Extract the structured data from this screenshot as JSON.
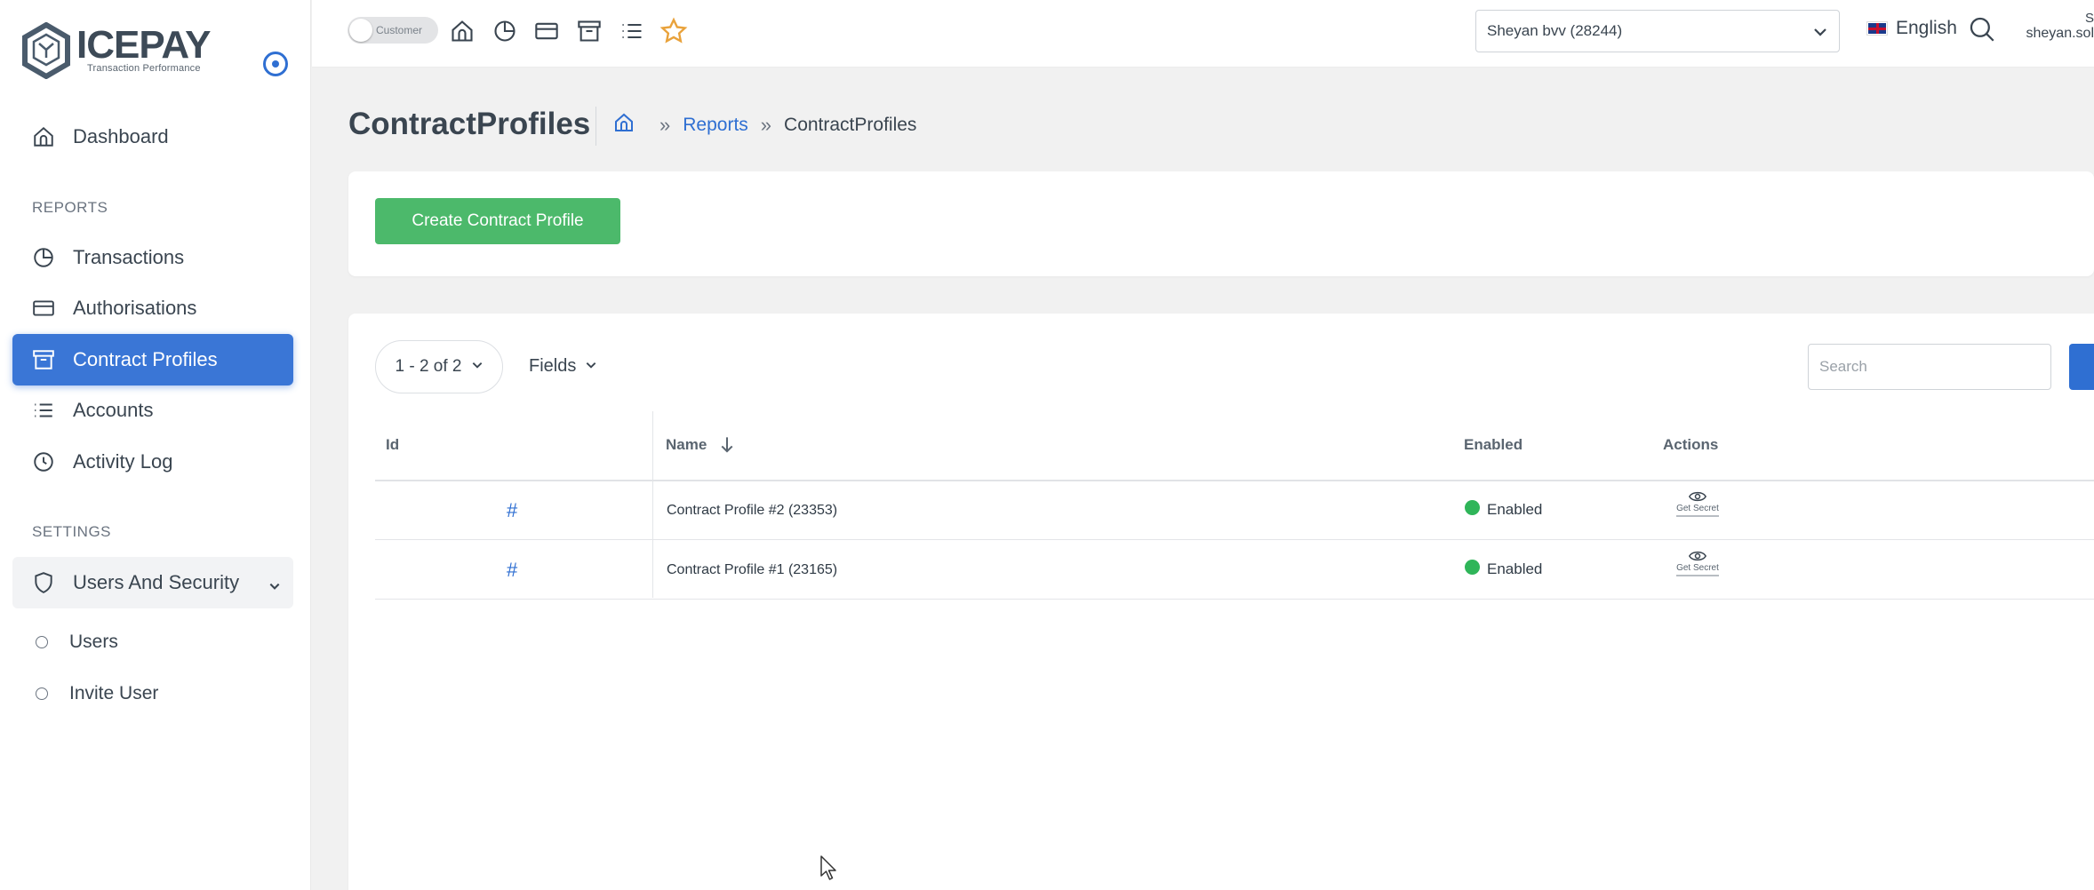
{
  "brand": {
    "name": "ICEPAY",
    "tagline": "Transaction Performance"
  },
  "sidebar": {
    "dashboard": "Dashboard",
    "reports_label": "REPORTS",
    "reports": [
      "Transactions",
      "Authorisations",
      "Contract Profiles",
      "Accounts",
      "Activity Log"
    ],
    "settings_label": "SETTINGS",
    "users_security": "Users And Security",
    "sub_items": [
      "Users",
      "Invite User"
    ],
    "active_item": "Contract Profiles"
  },
  "topbar": {
    "switch_label": "Customer",
    "merchant": "Sheyan bvv (28244)",
    "language": "English",
    "user_initial": "S",
    "user_email": "sheyan.sol"
  },
  "page": {
    "title": "ContractProfiles",
    "breadcrumb": [
      "Reports",
      "ContractProfiles"
    ]
  },
  "toolbar": {
    "create_label": "Create Contract Profile",
    "range": "1 - 2 of 2",
    "fields": "Fields",
    "search_placeholder": "Search"
  },
  "table": {
    "columns": [
      "Id",
      "Name",
      "Enabled",
      "Actions"
    ],
    "rows": [
      {
        "id": "#",
        "name": "Contract Profile #2 (23353)",
        "enabled": "Enabled",
        "action": "Get Secret"
      },
      {
        "id": "#",
        "name": "Contract Profile #1 (23165)",
        "enabled": "Enabled",
        "action": "Get Secret"
      }
    ]
  },
  "colors": {
    "accent": "#2f6fd2",
    "active_nav": "#3a76d6",
    "create_button": "#4cb96b",
    "enabled_dot": "#2fb559",
    "star": "#e9a23b"
  }
}
